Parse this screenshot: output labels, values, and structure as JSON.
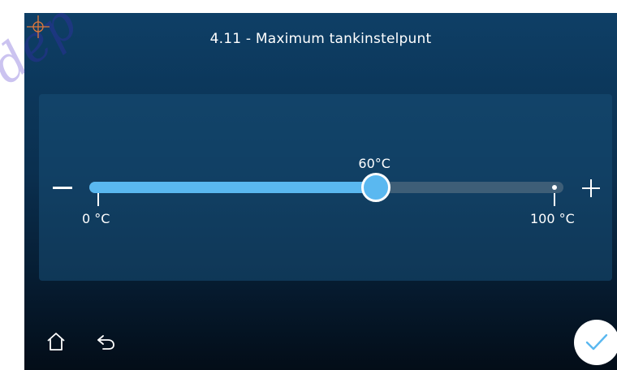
{
  "screen": {
    "title": "4.11 - Maximum tankinstelpunt"
  },
  "slider": {
    "value": 60,
    "value_label": "60°C",
    "min": 0,
    "max": 100,
    "min_label": "0 °C",
    "max_label": "100 °C",
    "fill_color": "#5ab8f0",
    "track_color": "#3e5e77"
  },
  "icons": {
    "minus": "minus-icon",
    "plus": "plus-icon",
    "home": "home-icon",
    "back": "back-arrow-icon",
    "confirm": "checkmark-icon"
  },
  "colors": {
    "accent": "#5ab8f0",
    "background_top": "#0e3f66",
    "background_bottom": "#030d18"
  }
}
